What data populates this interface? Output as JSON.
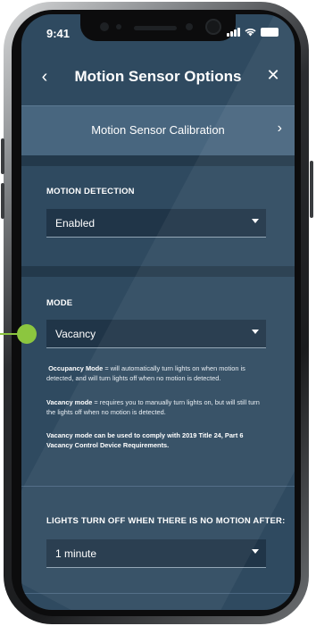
{
  "status_bar": {
    "time": "9:41"
  },
  "header": {
    "title": "Motion Sensor Options",
    "back_glyph": "‹",
    "close_glyph": "✕"
  },
  "calibration": {
    "label": "Motion Sensor Calibration",
    "chevron": "›"
  },
  "motion_detection": {
    "label": "MOTION DETECTION",
    "selected": "Enabled"
  },
  "mode": {
    "label": "MODE",
    "selected": "Vacancy",
    "occupancy_title": "Occupancy Mode",
    "occupancy_text": " = will automatically turn lights on when motion is detected, and will turn lights off when no motion is detected.",
    "vacancy_title": "Vacancy mode",
    "vacancy_text": " = requires you to manually turn lights on, but will still turn the lights off when no motion is detected.",
    "compliance_note": "Vacancy mode can be used to comply with 2019 Title 24, Part 6 Vacancy Control Device Requirements."
  },
  "lights_off": {
    "label": "LIGHTS TURN OFF WHEN THERE IS NO MOTION AFTER:",
    "selected": "1 minute"
  },
  "colors": {
    "accent_pointer": "#8cc63f",
    "background": "#2f4a60",
    "field": "#203548"
  }
}
